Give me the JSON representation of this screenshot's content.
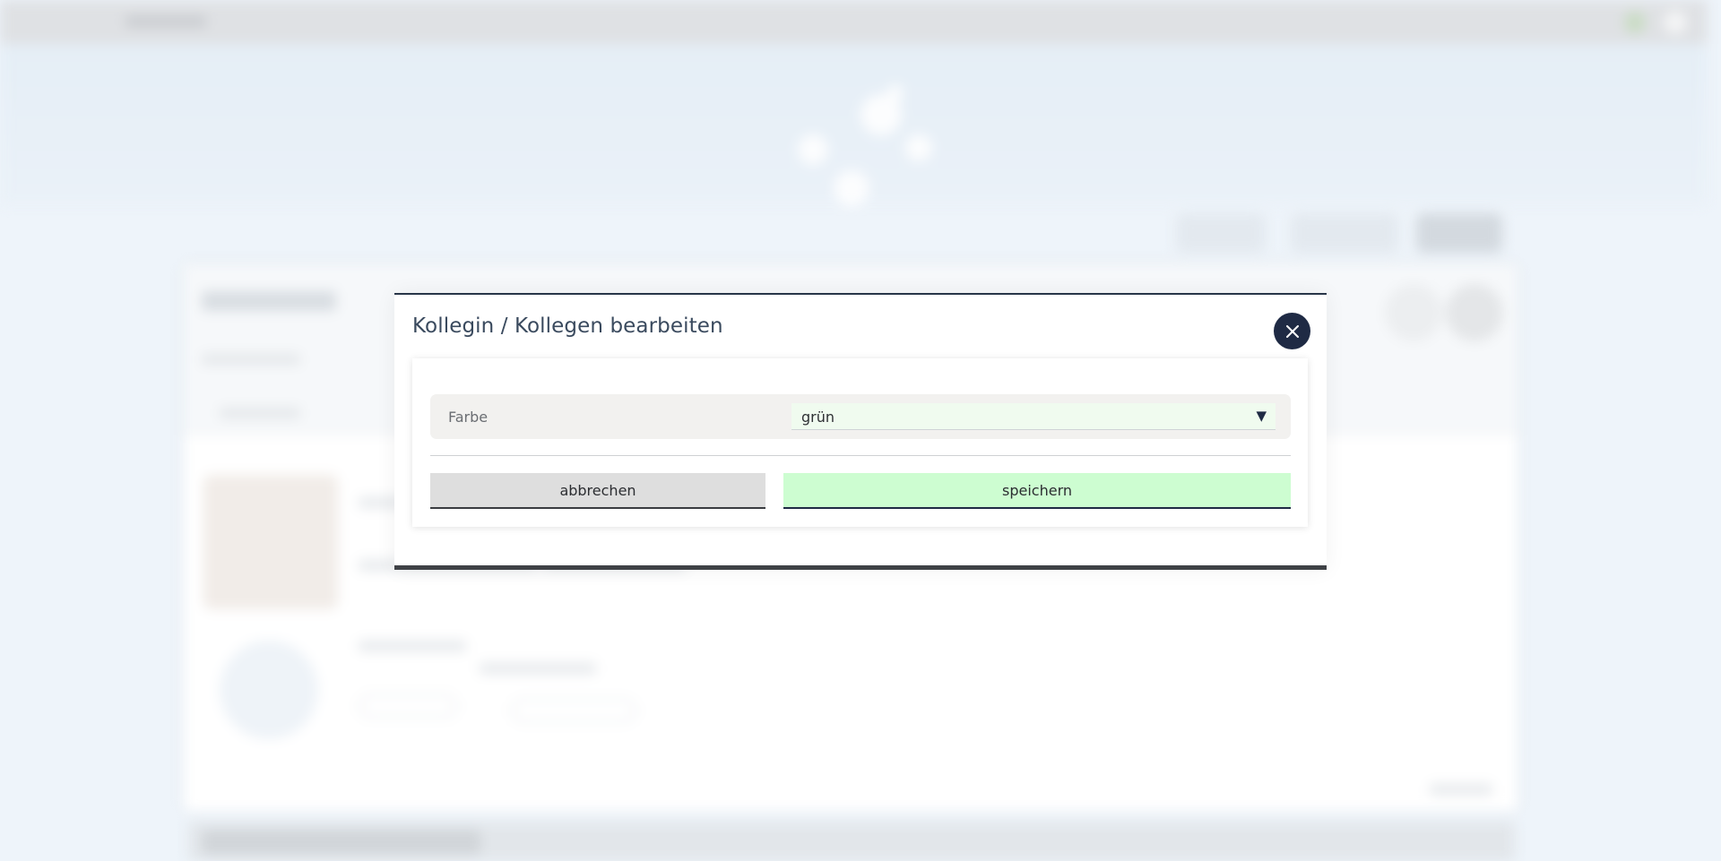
{
  "dialog": {
    "title": "Kollegin / Kollegen bearbeiten",
    "close_icon": "close-icon",
    "field": {
      "label": "Farbe",
      "selected_value": "grün",
      "dropdown_icon": "triangle-down-icon"
    },
    "buttons": {
      "cancel_label": "abbrechen",
      "save_label": "speichern"
    }
  },
  "colors": {
    "accent_dark": "#1f2a44",
    "save_button_bg": "#cdfdd1",
    "cancel_button_bg": "#dedede",
    "select_bg": "#f0fbef",
    "field_row_bg": "#f2f1ef"
  }
}
